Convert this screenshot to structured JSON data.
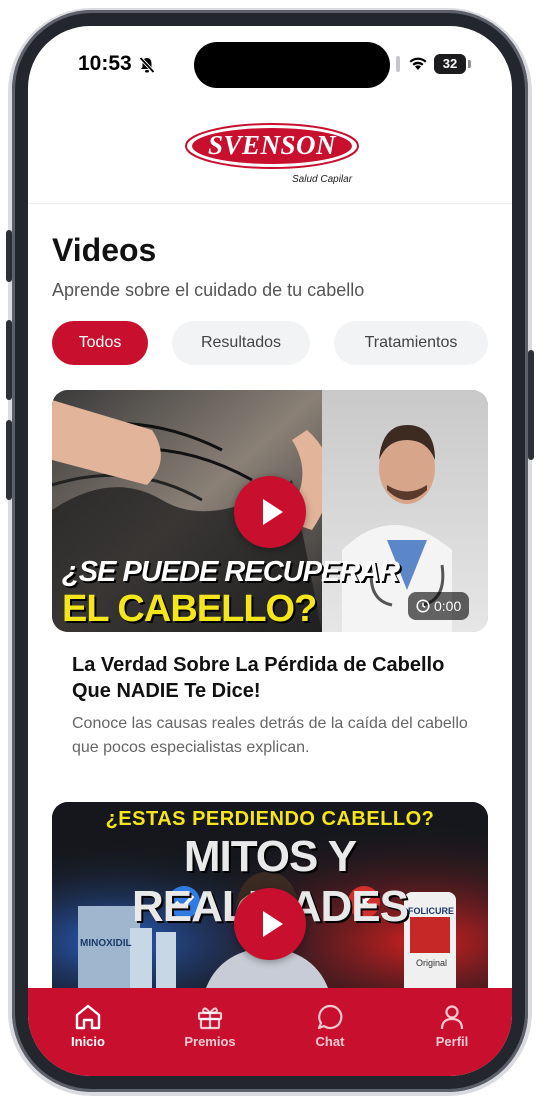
{
  "status_bar": {
    "time": "10:53",
    "battery": "32"
  },
  "header": {
    "logo_text": "SVENSON",
    "logo_tagline": "Salud Capilar"
  },
  "page": {
    "title": "Videos",
    "subtitle": "Aprende sobre el cuidado de tu cabello"
  },
  "filters": [
    {
      "label": "Todos",
      "active": true
    },
    {
      "label": "Resultados",
      "active": false
    },
    {
      "label": "Tratamientos",
      "active": false
    }
  ],
  "videos": [
    {
      "thumbnail_line1": "¿SE PUEDE RECUPERAR",
      "thumbnail_line2": "EL CABELLO?",
      "duration": "0:00",
      "title": "La Verdad Sobre La Pérdida de Cabello Que NADIE Te Dice!",
      "description": "Conoce las causas reales detrás de la caída del cabello que pocos especialistas explican."
    },
    {
      "thumbnail_line1": "¿ESTAS PERDIENDO CABELLO?",
      "thumbnail_line2": "MITOS Y REALIDADES",
      "product_left": "MINOXIDIL",
      "product_right": "FOLICURE",
      "product_right_sub": "Original"
    }
  ],
  "bottom_nav": [
    {
      "label": "Inicio",
      "icon": "home-icon",
      "active": true
    },
    {
      "label": "Premios",
      "icon": "gift-icon",
      "active": false
    },
    {
      "label": "Chat",
      "icon": "chat-icon",
      "active": false
    },
    {
      "label": "Perfil",
      "icon": "user-icon",
      "active": false
    }
  ],
  "colors": {
    "brand": "#c8102e",
    "chip_inactive": "#f2f3f5",
    "thumb_yellow": "#f5e51b"
  }
}
